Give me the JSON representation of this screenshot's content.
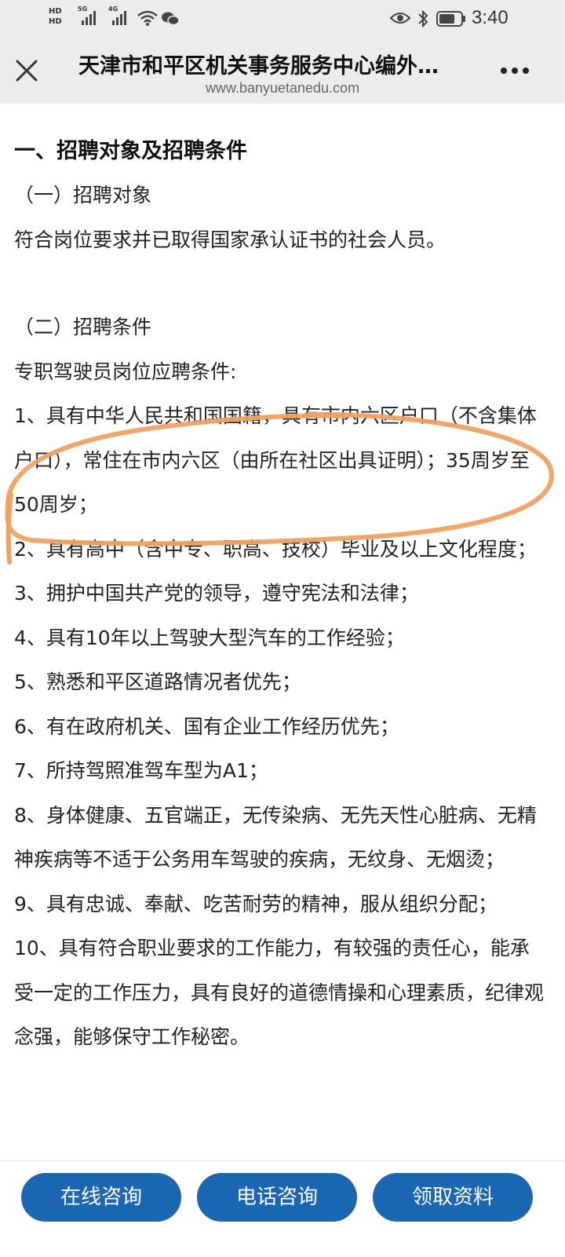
{
  "status_bar": {
    "time": "3:40",
    "hd1": "HD",
    "hd2": "HD",
    "net1": "5G",
    "net2": "4G"
  },
  "header": {
    "title": "天津市和平区机关事务服务中心编外…",
    "url": "www.banyuetanedu.com"
  },
  "article": {
    "heading": "一、招聘对象及招聘条件",
    "sub1": "（一）招聘对象",
    "target": "符合岗位要求并已取得国家承认证书的社会人员。",
    "sub2": "（二）招聘条件",
    "intro": "专职驾驶员岗位应聘条件:",
    "items": [
      "1、具有中华人民共和国国籍，具有市内六区户口（不含集体户口），常住在市内六区（由所在社区出具证明）；35周岁至50周岁；",
      "2、具有高中（含中专、职高、技校）毕业及以上文化程度；",
      "3、拥护中国共产党的领导，遵守宪法和法律；",
      "4、具有10年以上驾驶大型汽车的工作经验；",
      "5、熟悉和平区道路情况者优先；",
      "6、有在政府机关、国有企业工作经历优先；",
      "7、所持驾照准驾车型为A1；",
      "8、身体健康、五官端正，无传染病、无先天性心脏病、无精神疾病等不适于公务用车驾驶的疾病，无纹身、无烟烫；",
      "9、具有忠诚、奉献、吃苦耐劳的精神，服从组织分配；",
      "10、具有符合职业要求的工作能力，有较强的责任心，能承受一定的工作压力，具有良好的道德情操和心理素质，纪律观念强，能够保守工作秘密。"
    ]
  },
  "bottom_bar": {
    "btn_online": "在线咨询",
    "btn_phone": "电话咨询",
    "btn_materials": "领取资料"
  },
  "colors": {
    "accent_button": "#1a66b3",
    "annotation": "#f0a060",
    "chrome_bg": "#ececec"
  },
  "icons": [
    "close-icon",
    "more-icon",
    "signal-icon",
    "wifi-icon",
    "wechat-icon",
    "eye-icon",
    "bluetooth-icon",
    "battery-icon"
  ]
}
